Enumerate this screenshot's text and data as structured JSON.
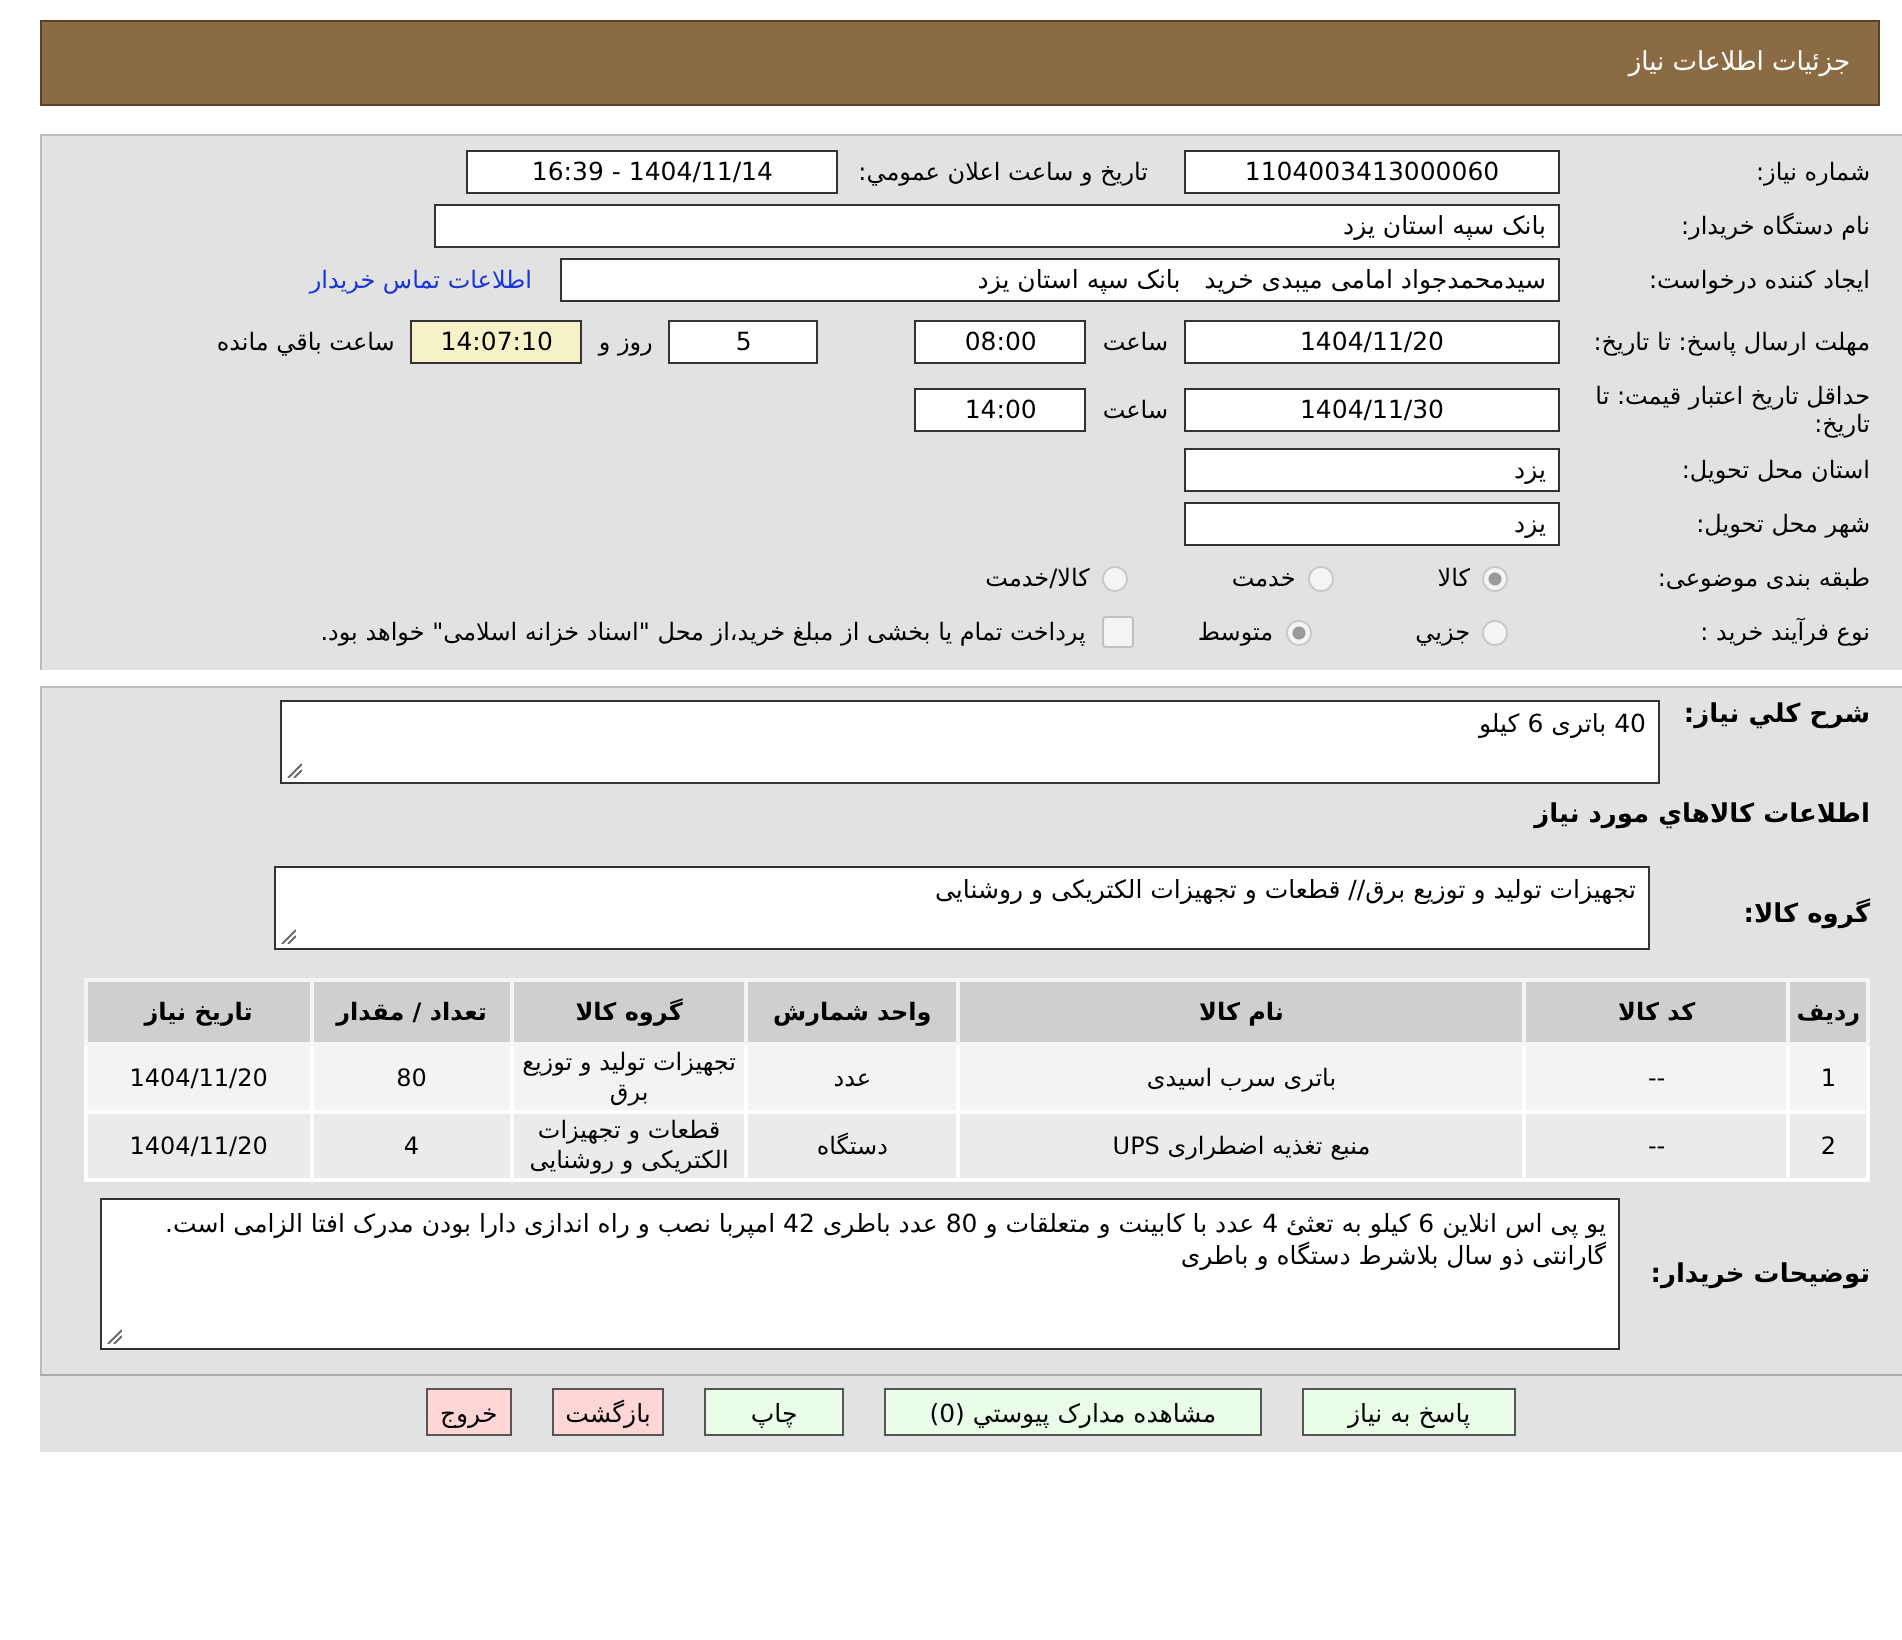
{
  "header": {
    "title": "جزئیات اطلاعات نیاز"
  },
  "need_number": {
    "label": "شماره نیاز:",
    "value": "1104003413000060"
  },
  "announce": {
    "label": "تاریخ و ساعت اعلان عمومي:",
    "value": "1404/11/14 - 16:39"
  },
  "buyer_org": {
    "label": "نام دستگاه خریدار:",
    "value": "بانک سپه استان یزد"
  },
  "requester": {
    "label": "ایجاد کننده درخواست:",
    "value": "سیدمحمدجواد امامی میبدی خرید   بانک سپه استان یزد",
    "link": "اطلاعات تماس خریدار"
  },
  "deadline": {
    "label": "مهلت ارسال پاسخ: تا تاریخ:",
    "date": "1404/11/20",
    "time_label": "ساعت",
    "time": "08:00",
    "days": "5",
    "days_label": "روز و",
    "remaining": "14:07:10",
    "remaining_label": "ساعت باقي مانده"
  },
  "validity": {
    "label": "حداقل تاریخ اعتبار قیمت: تا تاریخ:",
    "date": "1404/11/30",
    "time_label": "ساعت",
    "time": "14:00"
  },
  "province": {
    "label": "استان محل تحویل:",
    "value": "یزد"
  },
  "city": {
    "label": "شهر محل تحویل:",
    "value": "یزد"
  },
  "category": {
    "label": "طبقه بندی موضوعی:",
    "options": [
      {
        "label": "کالا",
        "selected": true
      },
      {
        "label": "خدمت",
        "selected": false
      },
      {
        "label": "کالا/خدمت",
        "selected": false
      }
    ]
  },
  "process": {
    "label": "نوع فرآیند خرید :",
    "options": [
      {
        "label": "جزيي",
        "selected": false
      },
      {
        "label": "متوسط",
        "selected": true
      }
    ],
    "treasury": {
      "checked": false,
      "label": "پرداخت تمام یا بخشی از مبلغ خرید،از محل \"اسناد خزانه اسلامی\" خواهد بود."
    }
  },
  "description": {
    "label": "شرح كلي نياز:",
    "value": "40 باتری 6 کیلو"
  },
  "goods_title": "اطلاعات كالاهاي مورد نياز",
  "goods_group": {
    "label": "گروه کالا:",
    "value": "تجهیزات تولید و توزیع برق// قطعات و تجهیزات الکتریکی و روشنایی"
  },
  "table": {
    "columns": [
      "ردیف",
      "کد کالا",
      "نام کالا",
      "واحد شمارش",
      "گروه کالا",
      "تعداد / مقدار",
      "تاریخ نیاز"
    ],
    "rows": [
      [
        "1",
        "--",
        "باتری سرب اسیدی",
        "عدد",
        "تجهیزات تولید و توزیع برق",
        "80",
        "1404/11/20"
      ],
      [
        "2",
        "--",
        "منبع تغذیه اضطراری UPS",
        "دستگاه",
        "قطعات و تجهیزات الکتریکی و روشنایی",
        "4",
        "1404/11/20"
      ]
    ]
  },
  "buyer_notes": {
    "label": "توضیحات خریدار:",
    "value": "یو پی اس انلاین 6 کیلو به تعثئ 4 عدد با کابینت و متعلقات و 80 عدد باطری 42 امپربا نصب و راه اندازی دارا بودن مدرک افتا الزامی است. گارانتی ذو سال بلاشرط دستگاه و باطری"
  },
  "buttons": [
    {
      "label": "پاسخ به نیاز",
      "kind": "normal"
    },
    {
      "label": "مشاهده مدارک پیوستي (0)",
      "kind": "normal"
    },
    {
      "label": "چاپ",
      "kind": "normal"
    },
    {
      "label": "بازگشت",
      "kind": "danger"
    },
    {
      "label": "خروج",
      "kind": "danger"
    }
  ]
}
